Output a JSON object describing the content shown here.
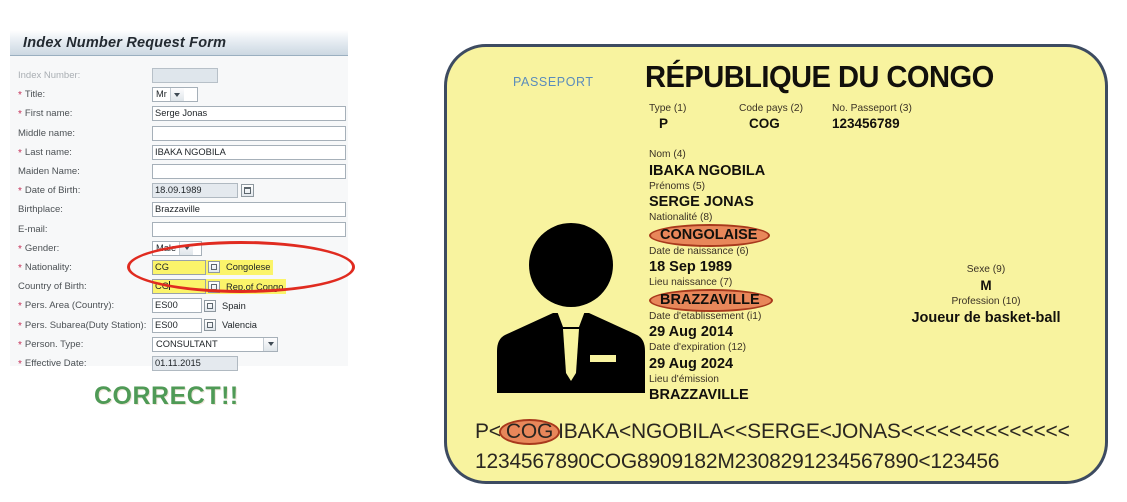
{
  "form": {
    "title": "Index Number Request Form",
    "rows": [
      {
        "label": "Index Number:",
        "required": false,
        "disabled": true,
        "control": "input-readonly",
        "value": ""
      },
      {
        "label": "Title:",
        "required": true,
        "control": "combo",
        "value": "Mr"
      },
      {
        "label": "First name:",
        "required": true,
        "control": "input",
        "value": "Serge Jonas"
      },
      {
        "label": "Middle name:",
        "required": false,
        "control": "input",
        "value": ""
      },
      {
        "label": "Last name:",
        "required": true,
        "control": "input",
        "value": "IBAKA NGOBILA"
      },
      {
        "label": "Maiden Name:",
        "required": false,
        "control": "input",
        "value": ""
      },
      {
        "label": "Date of Birth:",
        "required": true,
        "control": "date",
        "value": "18.09.1989"
      },
      {
        "label": "Birthplace:",
        "required": false,
        "control": "input",
        "value": "Brazzaville"
      },
      {
        "label": "E-mail:",
        "required": false,
        "control": "input",
        "value": ""
      },
      {
        "label": "Gender:",
        "required": true,
        "control": "combo",
        "value": "Male"
      },
      {
        "label": "Nationality:",
        "required": true,
        "control": "lookup",
        "value": "CG",
        "side": "Congolese",
        "highlight": true
      },
      {
        "label": "Country of Birth:",
        "required": false,
        "control": "lookup",
        "value": "CG",
        "side": "Rep.of Congo",
        "highlight": true,
        "focused": true
      },
      {
        "label": "Pers. Area (Country):",
        "required": true,
        "control": "lookup",
        "value": "ES00",
        "side": "Spain"
      },
      {
        "label": "Pers. Subarea(Duty Station):",
        "required": true,
        "control": "lookup",
        "value": "ES00",
        "side": "Valencia"
      },
      {
        "label": "Person. Type:",
        "required": true,
        "control": "combo",
        "value": "CONSULTANT"
      },
      {
        "label": "Effective Date:",
        "required": true,
        "control": "input-readonly-date",
        "value": "01.11.2015"
      }
    ]
  },
  "annotation": {
    "correct_caption": "CORRECT!!",
    "ellipse_color": "#e02b20",
    "correct_color": "#4f9a56",
    "highlight_color": "#fbf46a"
  },
  "passport": {
    "passeport_label": "PASSEPORT",
    "country_title": "RÉPUBLIQUE DU CONGO",
    "card_bg": "#f8f39f",
    "card_border": "#3d4b61",
    "callout_fill": "#e8875a",
    "callout_stroke": "#a8391c",
    "top_fields": [
      {
        "caption": "Type (1)",
        "value": "P"
      },
      {
        "caption": "Code pays (2)",
        "value": "COG"
      },
      {
        "caption": "No. Passeport (3)",
        "value": "123456789"
      }
    ],
    "fields": [
      {
        "caption": "Nom (4)",
        "value": "IBAKA NGOBILA",
        "callout": false
      },
      {
        "caption": "Prénoms (5)",
        "value": "SERGE JONAS",
        "callout": false
      },
      {
        "caption": "Nationalité (8)",
        "value": "CONGOLAISE",
        "callout": true
      },
      {
        "caption": "Date de naissance (6)",
        "value": "18 Sep 1989",
        "callout": false
      },
      {
        "caption": "Lieu naissance (7)",
        "value": "BRAZZAVILLE",
        "callout": true
      },
      {
        "caption": "Date d'etablissement (i1)",
        "value": "29 Aug 2014",
        "callout": false
      },
      {
        "caption": "Date d'expiration (12)",
        "value": "29 Aug 2024",
        "callout": false
      },
      {
        "caption": "Lieu d'émission",
        "value": "BRAZZAVILLE",
        "callout": false
      }
    ],
    "right_fields": [
      {
        "caption": "Sexe  (9)",
        "value": "M"
      },
      {
        "caption": "Profession (10)",
        "value": "Joueur de basket-ball"
      }
    ],
    "avatar_icon": "person-in-suit-icon",
    "mrz": {
      "line1_prefix": "P<",
      "line1_callout": "COG",
      "line1_suffix": "IBAKA<NGOBILA<<SERGE<JONAS<<<<<<<<<<<<<<",
      "line2": "1234567890COG8909182M2308291234567890<123456"
    }
  }
}
